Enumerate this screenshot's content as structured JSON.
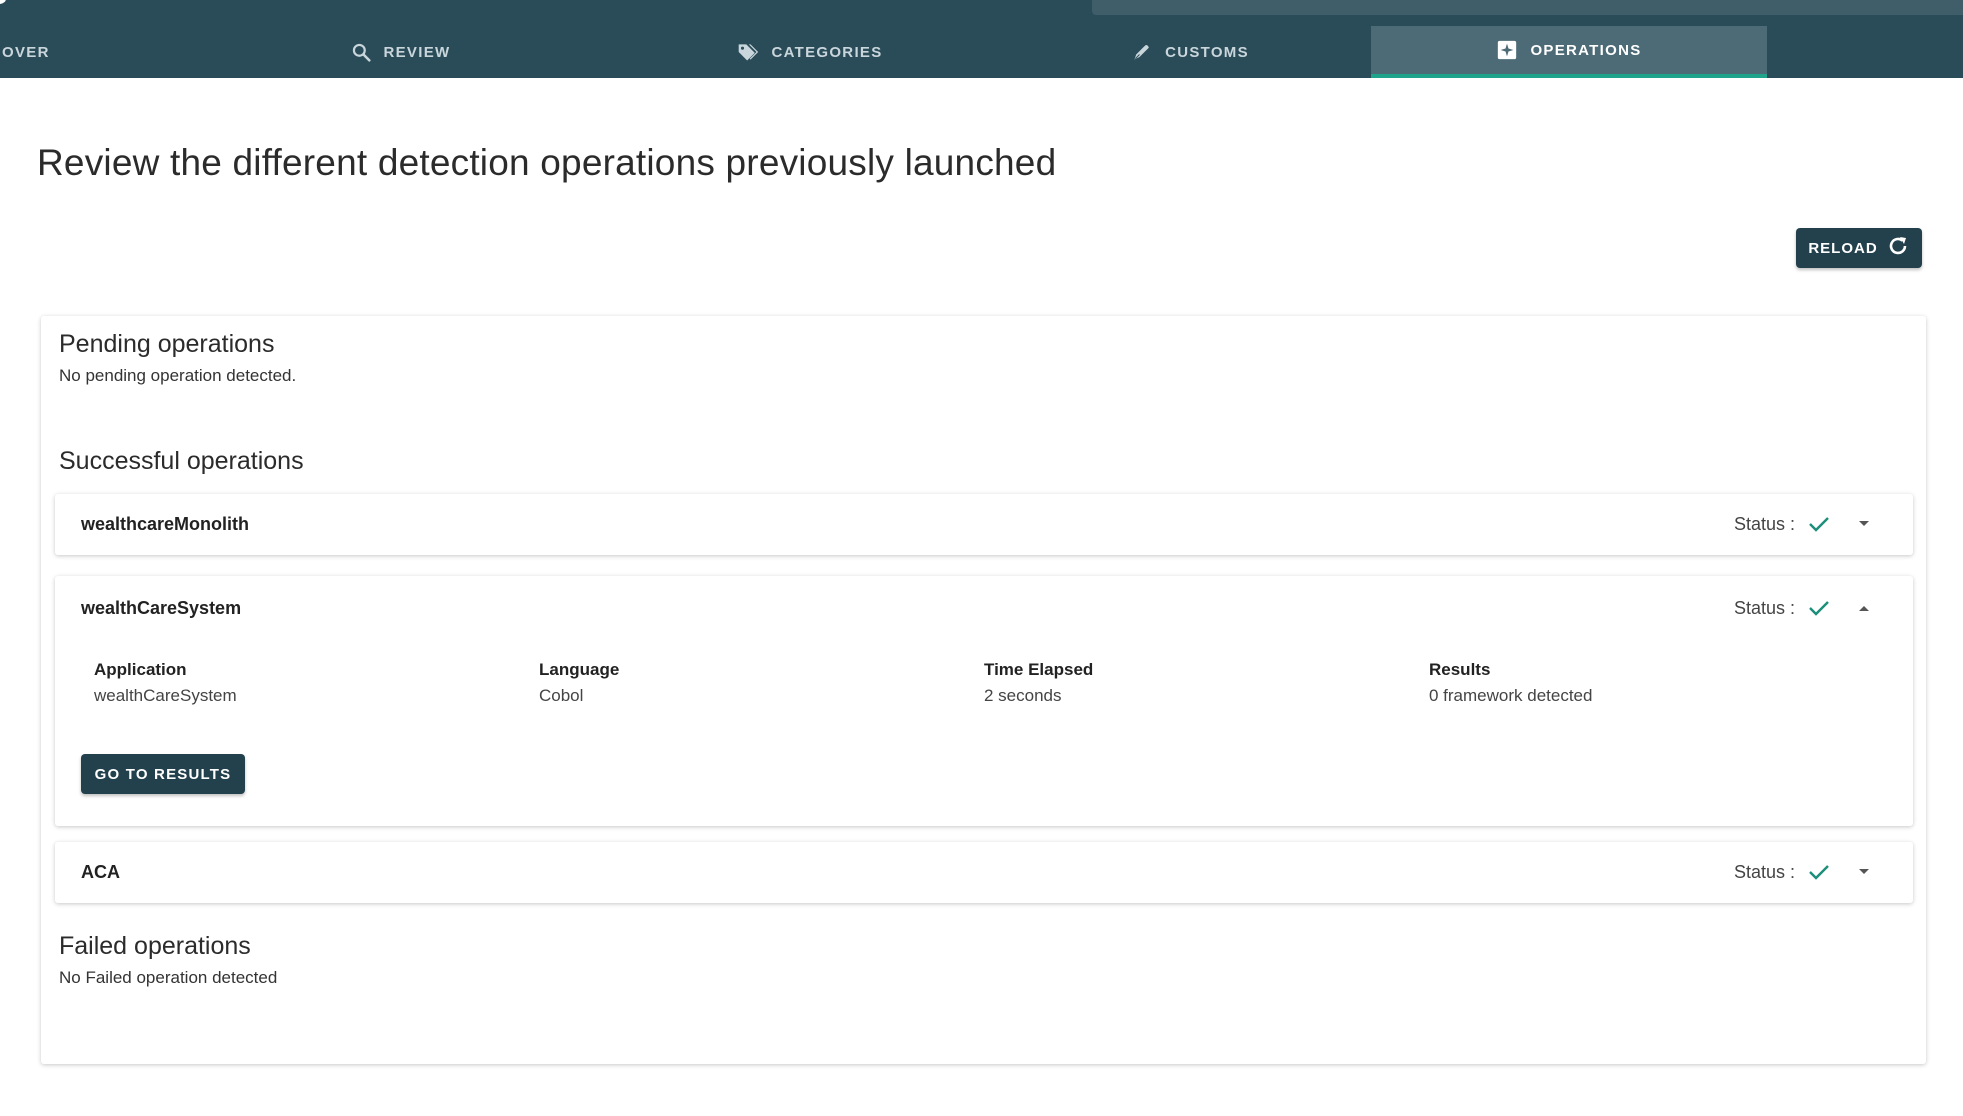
{
  "nav": {
    "tabs": [
      {
        "label": "OVER",
        "icon": "none"
      },
      {
        "label": "REVIEW",
        "icon": "search-icon"
      },
      {
        "label": "CATEGORIES",
        "icon": "tags-icon"
      },
      {
        "label": "CUSTOMS",
        "icon": "pen-icon"
      },
      {
        "label": "OPERATIONS",
        "icon": "plus-box-icon",
        "active": true
      }
    ]
  },
  "page": {
    "title": "Review the different detection operations previously launched",
    "reload_label": "RELOAD"
  },
  "pending": {
    "title": "Pending operations",
    "message": "No pending operation detected."
  },
  "successful": {
    "title": "Successful operations",
    "status_label": "Status :",
    "items": [
      {
        "name": "wealthcareMonolith",
        "expanded": false
      },
      {
        "name": "wealthCareSystem",
        "expanded": true,
        "details": [
          {
            "label": "Application",
            "value": "wealthCareSystem"
          },
          {
            "label": "Language",
            "value": "Cobol"
          },
          {
            "label": "Time Elapsed",
            "value": "2 seconds"
          },
          {
            "label": "Results",
            "value": "0 framework detected"
          }
        ],
        "button_label": "GO TO RESULTS"
      },
      {
        "name": "ACA",
        "expanded": false
      }
    ]
  },
  "failed": {
    "title": "Failed operations",
    "message": "No Failed operation detected"
  },
  "colors": {
    "nav_bg": "#2a4b58",
    "accent": "#1fa38a",
    "button_bg": "#23404d",
    "check": "#1b8f7a"
  }
}
